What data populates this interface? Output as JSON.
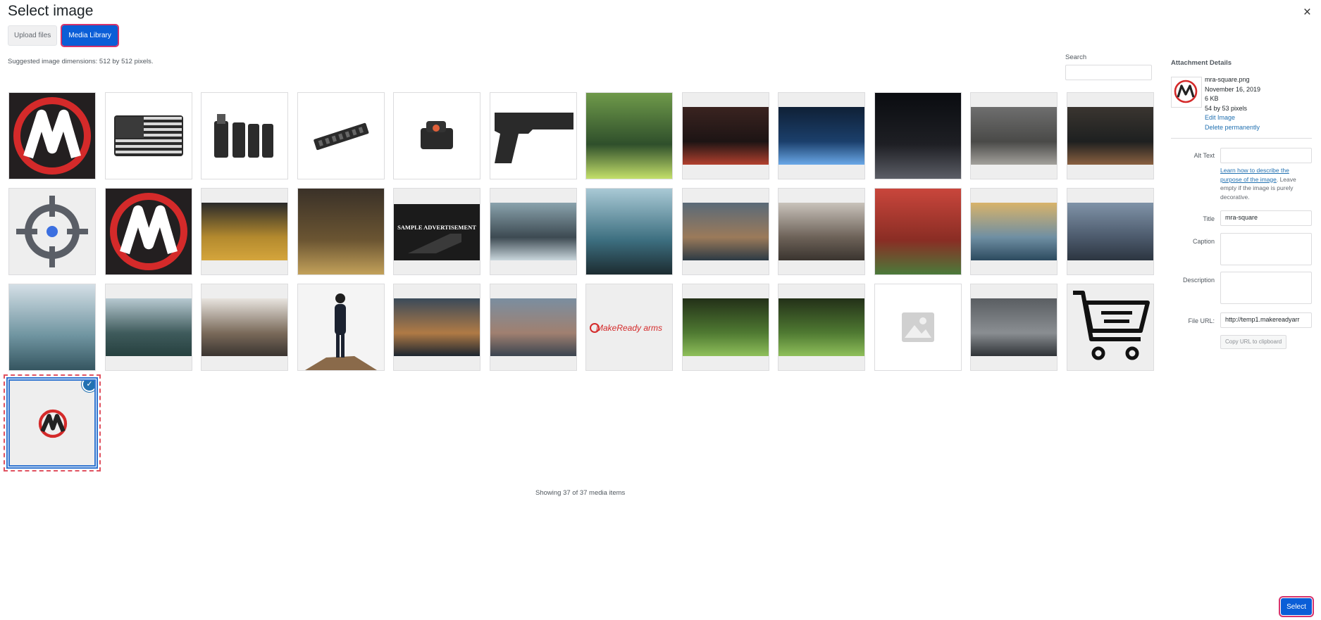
{
  "modal": {
    "title": "Select image",
    "close_glyph": "×"
  },
  "router": {
    "upload_label": "Upload files",
    "media_label": "Media Library",
    "active": "Media Library"
  },
  "toolbar": {
    "suggestion": "Suggested image dimensions: 512 by 512 pixels.",
    "search_label": "Search",
    "search_value": ""
  },
  "library": {
    "showing_text": "Showing 37 of 37 media items",
    "items": [
      {
        "kind": "logo-dark"
      },
      {
        "kind": "flag"
      },
      {
        "kind": "mag-pouch"
      },
      {
        "kind": "rail"
      },
      {
        "kind": "red-dot"
      },
      {
        "kind": "pistol"
      },
      {
        "kind": "photo",
        "colors": [
          "#6f9a4a",
          "#2f4f2b",
          "#c4e06a"
        ]
      },
      {
        "kind": "photo",
        "colors": [
          "#3a2320",
          "#1d1414",
          "#b2402e"
        ]
      },
      {
        "kind": "photo",
        "colors": [
          "#0f2036",
          "#1b3f6b",
          "#6aa8e8"
        ]
      },
      {
        "kind": "photo",
        "colors": [
          "#0a0c10",
          "#1e1f24",
          "#5c5e66"
        ]
      },
      {
        "kind": "photo",
        "colors": [
          "#6e6e6e",
          "#4a4a48",
          "#a3a19c"
        ]
      },
      {
        "kind": "photo",
        "colors": [
          "#3a3530",
          "#1e2020",
          "#8a6040"
        ]
      },
      {
        "kind": "crosshair"
      },
      {
        "kind": "logo-dark"
      },
      {
        "kind": "photo",
        "colors": [
          "#2a2a2a",
          "#b48a2e",
          "#d4a53c"
        ]
      },
      {
        "kind": "photo",
        "colors": [
          "#3a3128",
          "#6b5532",
          "#c3a15a"
        ]
      },
      {
        "kind": "ad",
        "text": "SAMPLE ADVERTISEMENT"
      },
      {
        "kind": "photo",
        "colors": [
          "#8aa3ad",
          "#3d4a52",
          "#c9d6dc"
        ]
      },
      {
        "kind": "photo",
        "colors": [
          "#a9c9d5",
          "#3d6f80",
          "#1c2b30"
        ]
      },
      {
        "kind": "photo",
        "colors": [
          "#5a6a78",
          "#9b7a5a",
          "#2c3a44"
        ]
      },
      {
        "kind": "photo",
        "colors": [
          "#c9c3bb",
          "#6d6258",
          "#3a342f"
        ]
      },
      {
        "kind": "photo",
        "colors": [
          "#c9463c",
          "#8a2d24",
          "#4b7a3a"
        ]
      },
      {
        "kind": "photo",
        "colors": [
          "#d8b36a",
          "#6f8fa3",
          "#2c4a5f"
        ]
      },
      {
        "kind": "photo",
        "colors": [
          "#8093a8",
          "#4c5a6c",
          "#2c3540"
        ]
      },
      {
        "kind": "photo",
        "colors": [
          "#d4dfe6",
          "#6f94a0",
          "#355560"
        ]
      },
      {
        "kind": "photo",
        "colors": [
          "#b7c9d1",
          "#3f5b5c",
          "#26403f"
        ]
      },
      {
        "kind": "photo",
        "colors": [
          "#e8e4df",
          "#7a6a5a",
          "#3a3430"
        ]
      },
      {
        "kind": "person"
      },
      {
        "kind": "photo",
        "colors": [
          "#3a4a5a",
          "#b07a45",
          "#1c2530"
        ]
      },
      {
        "kind": "photo",
        "colors": [
          "#7a8ea0",
          "#a08070",
          "#3a4450"
        ]
      },
      {
        "kind": "wordmark",
        "text": "MakeReady arms"
      },
      {
        "kind": "photo",
        "colors": [
          "#233018",
          "#4f7a32",
          "#8fbf5a"
        ]
      },
      {
        "kind": "photo",
        "colors": [
          "#233018",
          "#4f7a32",
          "#8fbf5a"
        ]
      },
      {
        "kind": "placeholder"
      },
      {
        "kind": "photo",
        "colors": [
          "#5a5e62",
          "#8a8e92",
          "#2e3236"
        ]
      },
      {
        "kind": "cart"
      },
      {
        "kind": "logo-light",
        "selected": true
      }
    ]
  },
  "details": {
    "heading": "Attachment Details",
    "filename": "mra-square.png",
    "date": "November 16, 2019",
    "size": "6 KB",
    "dimensions": "54 by 53 pixels",
    "edit_link": "Edit Image",
    "delete_link": "Delete permanently",
    "alt_label": "Alt Text",
    "alt_value": "",
    "alt_help_link": "Learn how to describe the purpose of the image",
    "alt_help_rest": ". Leave empty if the image is purely decorative.",
    "title_label": "Title",
    "title_value": "mra-square",
    "caption_label": "Caption",
    "caption_value": "",
    "description_label": "Description",
    "description_value": "",
    "url_label": "File URL:",
    "url_value": "http://temp1.makereadyarr",
    "copy_label": "Copy URL to clipboard"
  },
  "footer": {
    "select_label": "Select"
  },
  "colors": {
    "accent": "#0b5ed7",
    "highlight": "#d6336c",
    "brand_red": "#d42a2a"
  }
}
